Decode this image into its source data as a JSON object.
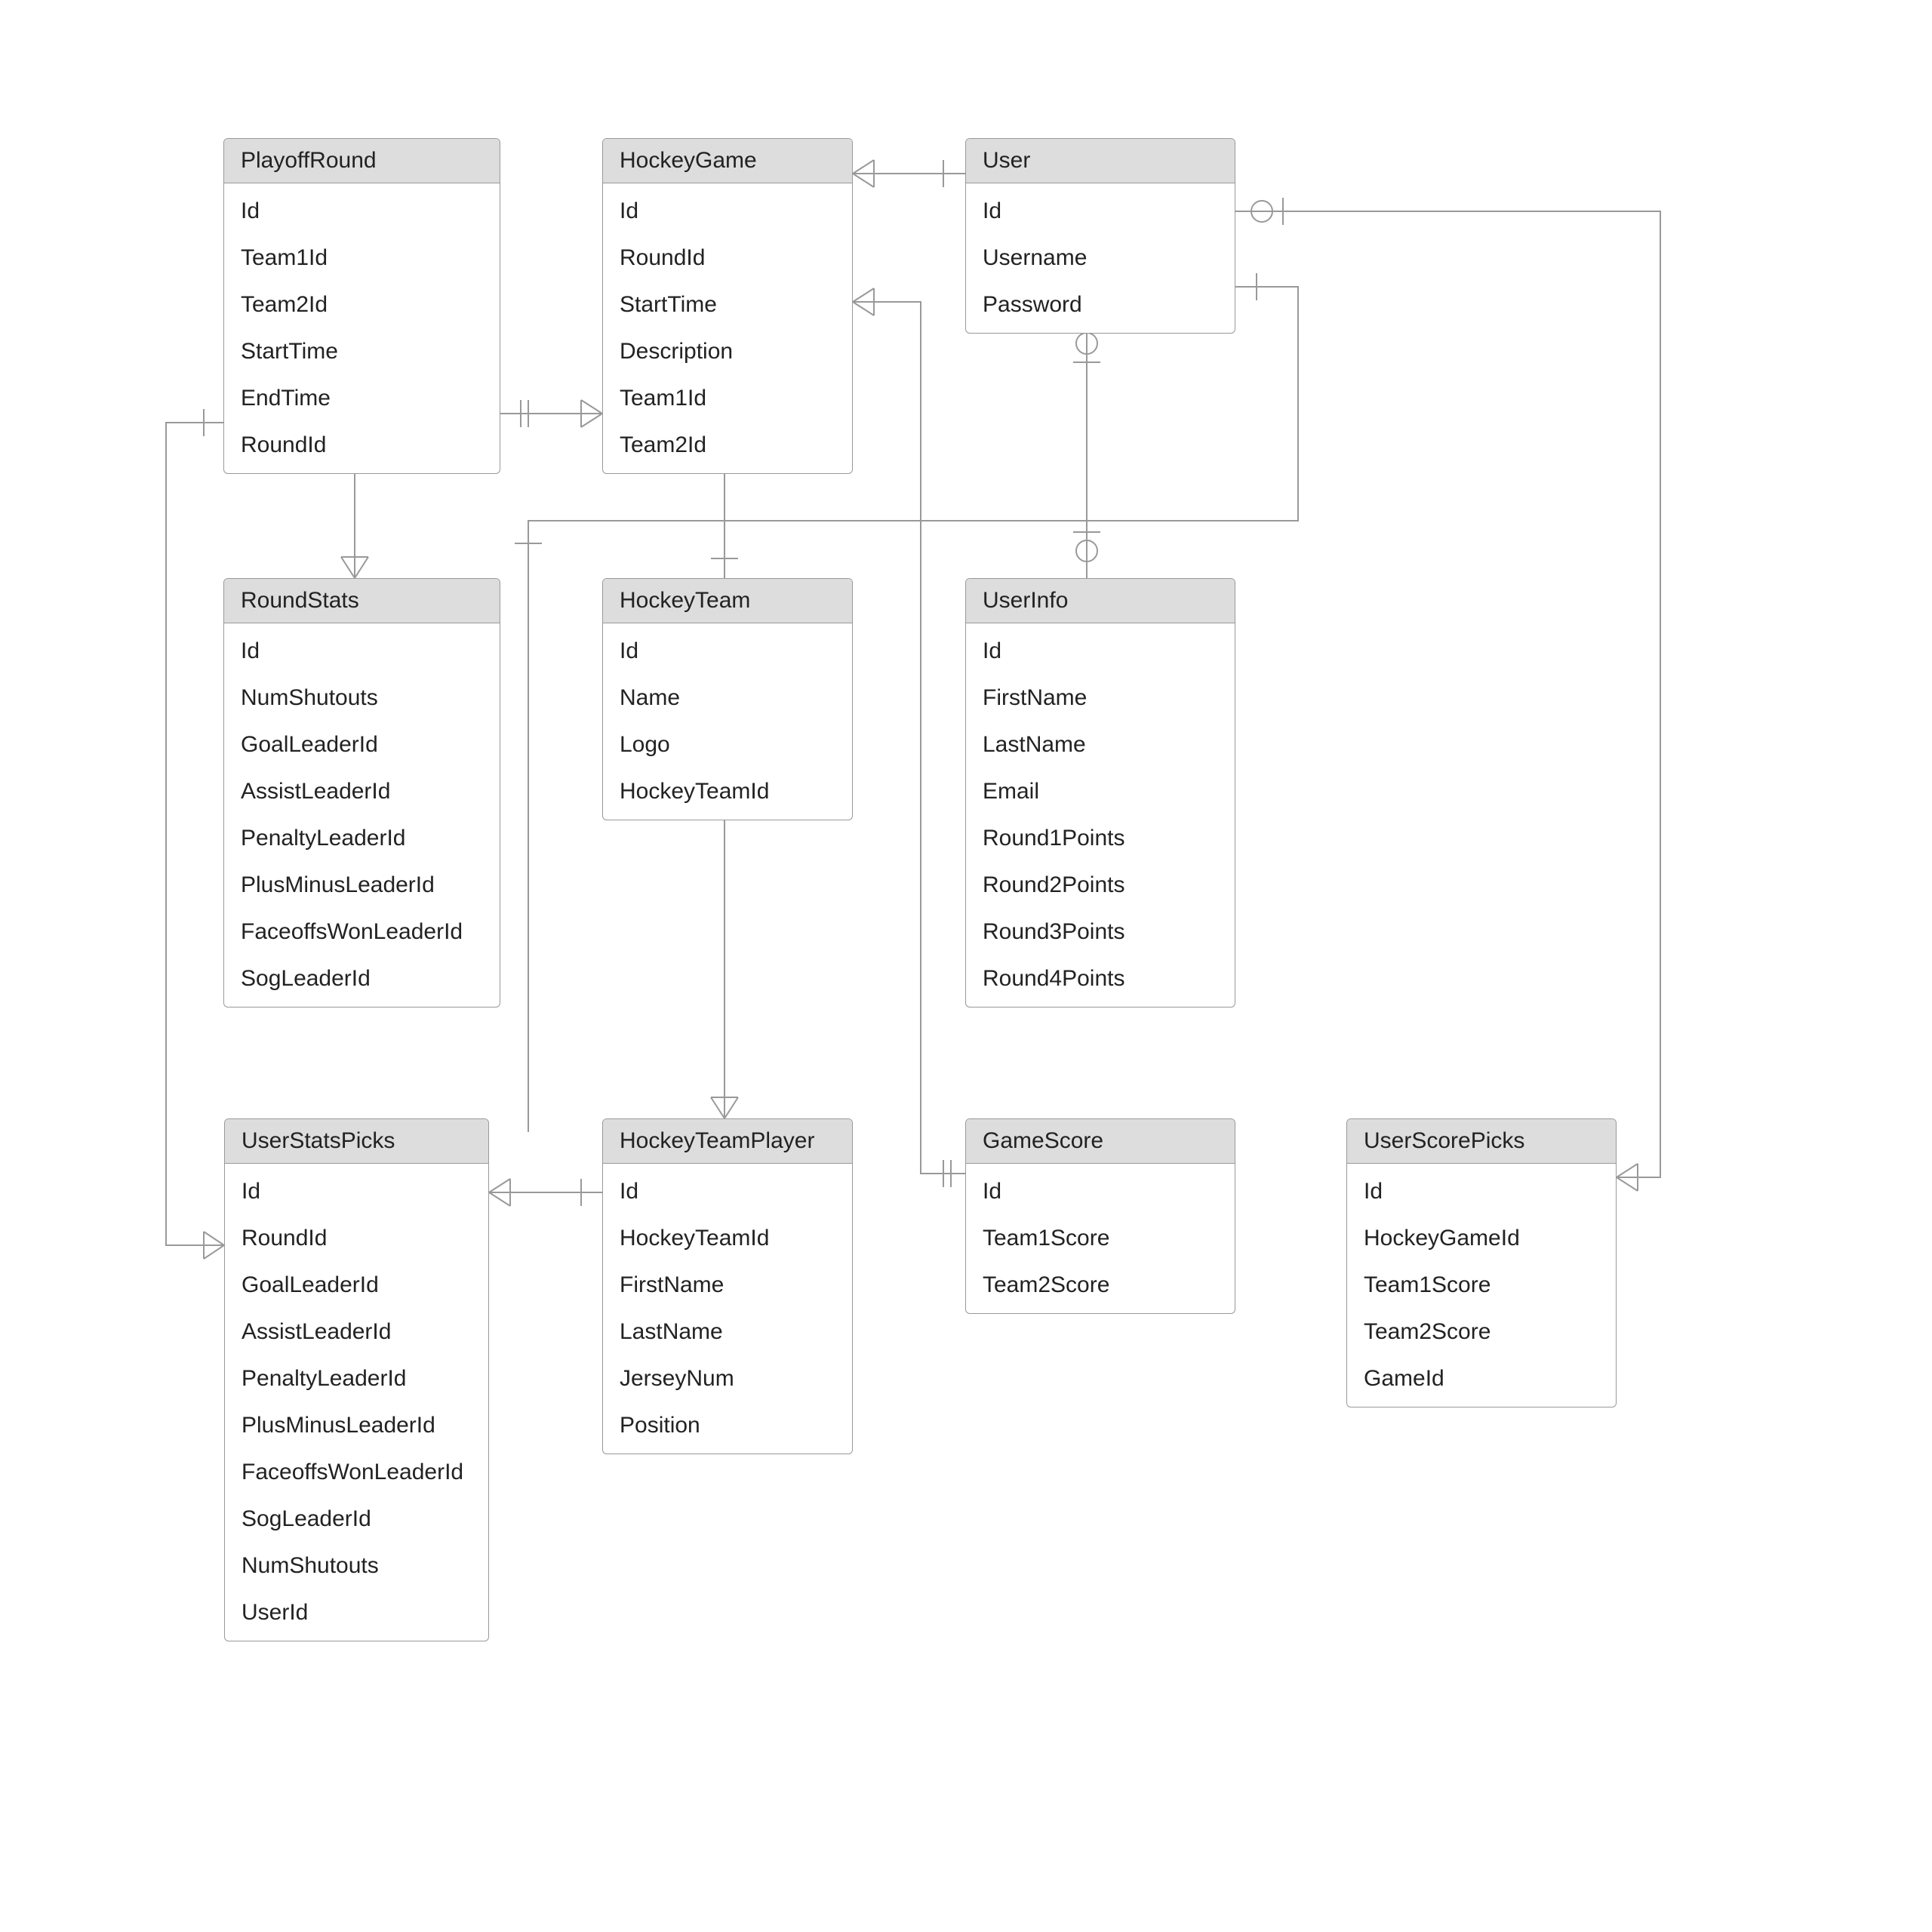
{
  "entities": {
    "playoffRound": {
      "title": "PlayoffRound",
      "rows": [
        "Id",
        "Team1Id",
        "Team2Id",
        "StartTime",
        "EndTime",
        "RoundId"
      ]
    },
    "hockeyGame": {
      "title": "HockeyGame",
      "rows": [
        "Id",
        "RoundId",
        "StartTime",
        "Description",
        "Team1Id",
        "Team2Id"
      ]
    },
    "user": {
      "title": "User",
      "rows": [
        "Id",
        "Username",
        "Password"
      ]
    },
    "roundStats": {
      "title": "RoundStats",
      "rows": [
        "Id",
        "NumShutouts",
        "GoalLeaderId",
        "AssistLeaderId",
        "PenaltyLeaderId",
        "PlusMinusLeaderId",
        "FaceoffsWonLeaderId",
        "SogLeaderId"
      ]
    },
    "hockeyTeam": {
      "title": "HockeyTeam",
      "rows": [
        "Id",
        "Name",
        "Logo",
        "HockeyTeamId"
      ]
    },
    "userInfo": {
      "title": "UserInfo",
      "rows": [
        "Id",
        "FirstName",
        "LastName",
        "Email",
        "Round1Points",
        "Round2Points",
        "Round3Points",
        "Round4Points"
      ]
    },
    "userStatsPicks": {
      "title": "UserStatsPicks",
      "rows": [
        "Id",
        "RoundId",
        "GoalLeaderId",
        "AssistLeaderId",
        "PenaltyLeaderId",
        "PlusMinusLeaderId",
        "FaceoffsWonLeaderId",
        "SogLeaderId",
        "NumShutouts",
        "UserId"
      ]
    },
    "hockeyTeamPlayer": {
      "title": "HockeyTeamPlayer",
      "rows": [
        "Id",
        "HockeyTeamId",
        "FirstName",
        "LastName",
        "JerseyNum",
        "Position"
      ]
    },
    "gameScore": {
      "title": "GameScore",
      "rows": [
        "Id",
        "Team1Score",
        "Team2Score"
      ]
    },
    "userScorePicks": {
      "title": "UserScorePicks",
      "rows": [
        "Id",
        "HockeyGameId",
        "Team1Score",
        "Team2Score",
        "GameId"
      ]
    }
  }
}
